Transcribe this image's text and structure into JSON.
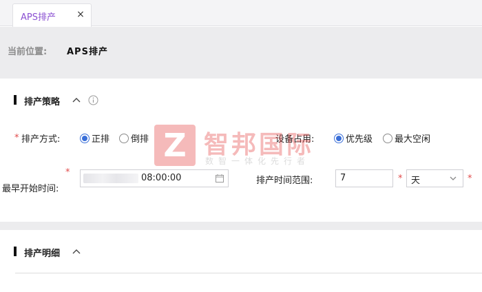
{
  "tab": {
    "label": "APS排产",
    "close_glyph": "×"
  },
  "breadcrumb": {
    "prefix": "当前位置:",
    "current": "APS排产"
  },
  "section_strategy": {
    "title": "排产策略",
    "schedule_mode": {
      "label": "排产方式:",
      "options": [
        "正排",
        "倒排"
      ],
      "selected": "正排"
    },
    "equipment_usage": {
      "label": "设备占用:",
      "options": [
        "优先级",
        "最大空闲"
      ],
      "selected": "优先级"
    },
    "earliest_start": {
      "label": "最早开始时间:",
      "time": "08:00:00"
    },
    "time_range": {
      "label": "排产时间范围:",
      "value": "7",
      "unit": "天"
    }
  },
  "section_detail": {
    "title": "排产明细"
  },
  "watermark": {
    "name": "智邦国际",
    "slogan": "数智一体化先行者",
    "logo_letter": "Z"
  },
  "colors": {
    "accent": "#3a6fd8",
    "tab_text": "#8a4fd1",
    "required": "#e14a4a",
    "watermark": "#e43b3b"
  }
}
